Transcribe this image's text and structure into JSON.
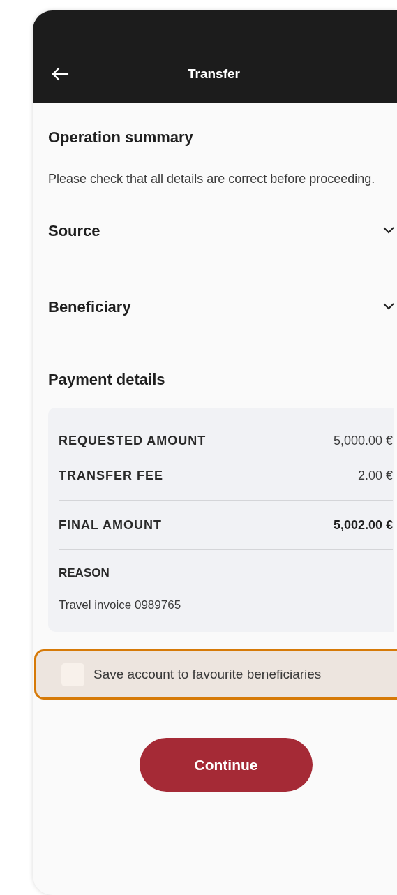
{
  "header": {
    "title": "Transfer"
  },
  "summary": {
    "title": "Operation summary",
    "description": "Please check that all details are correct before proceeding."
  },
  "sections": [
    {
      "title": "Source",
      "expanded": false
    },
    {
      "title": "Beneficiary",
      "expanded": false
    }
  ],
  "payment_details": {
    "title": "Payment details",
    "rows": [
      {
        "kind": "amount",
        "label": "REQUESTED AMOUNT",
        "value": "5,000.00 €"
      },
      {
        "kind": "amount",
        "label": "TRANSFER FEE",
        "value": "2.00 €"
      },
      {
        "kind": "total",
        "label": "FINAL AMOUNT",
        "value": "5,002.00 €"
      },
      {
        "kind": "note",
        "label": "REASON",
        "value": "Travel invoice 0989765"
      }
    ]
  },
  "save_favourite": {
    "label": "Save account to favourite beneficiaries",
    "checked": false,
    "focused": true
  },
  "continue_button": "Continue"
}
